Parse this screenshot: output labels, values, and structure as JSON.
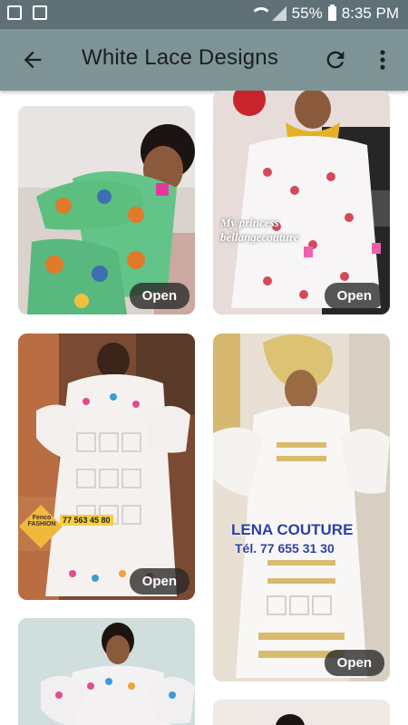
{
  "status_bar": {
    "battery": "55%",
    "time": "8:35 PM"
  },
  "app_bar": {
    "title": "White Lace Designs"
  },
  "cards": [
    {
      "open_label": "Open"
    },
    {
      "open_label": "Open",
      "watermark": "My princess bellangecouture"
    },
    {
      "open_label": "Open",
      "badge_brand": "Fenco FASHION",
      "badge_phone": "77 563 45 80"
    },
    {
      "open_label": "Open",
      "brand": "LENA COUTURE",
      "phone": "Tél. 77 655 31 30"
    },
    {
      "open_label": ""
    },
    {
      "open_label": ""
    }
  ],
  "colors": {
    "status_bar": "#5f7176",
    "app_bar": "#7e9497"
  }
}
